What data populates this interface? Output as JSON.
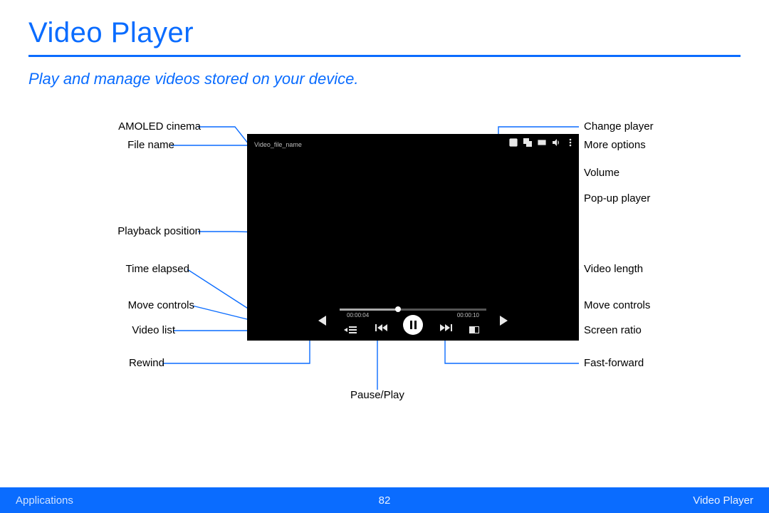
{
  "title": "Video Player",
  "subtitle": "Play and manage videos stored on your device.",
  "player": {
    "file_label": "Video_file_name",
    "time_elapsed": "00:00:04",
    "time_length": "00:00:10"
  },
  "labels": {
    "left": {
      "amoled": "AMOLED cinema",
      "file": "File name",
      "pos": "Playback position",
      "elapsed": "Time elapsed",
      "movectl": "Move controls",
      "vlist": "Video list",
      "rewind": "Rewind"
    },
    "right": {
      "change": "Change player",
      "more": "More options",
      "volume": "Volume",
      "popup": "Pop-up player",
      "length": "Video length",
      "movectl": "Move controls",
      "ratio": "Screen ratio",
      "ffwd": "Fast-forward"
    },
    "center": {
      "pause": "Pause/Play"
    }
  },
  "footer": {
    "left": "Applications",
    "page": "82",
    "right": "Video Player"
  }
}
